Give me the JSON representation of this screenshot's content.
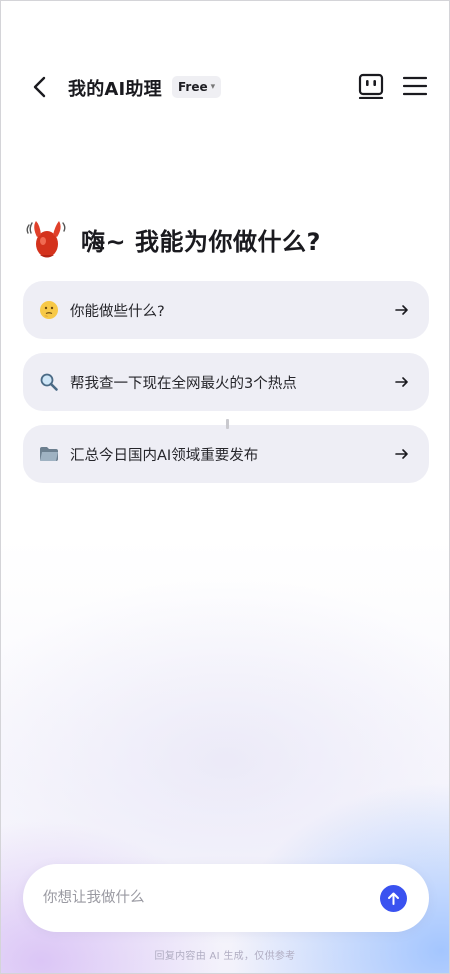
{
  "header": {
    "title": "我的AI助理",
    "plan_badge": "Free",
    "icons": [
      "back-arrow-icon",
      "robot-face-icon",
      "menu-icon"
    ]
  },
  "greeting": {
    "text": "嗨~ 我能为你做什么?",
    "icon": "lobster-icon"
  },
  "suggestions": [
    {
      "emoji": "thinking-face-icon",
      "label": "你能做些什么?"
    },
    {
      "emoji": "magnifying-glass-icon",
      "label": "帮我查一下现在全网最火的3个热点"
    },
    {
      "emoji": "folder-icon",
      "label": "汇总今日国内AI领域重要发布"
    }
  ],
  "input": {
    "placeholder": "你想让我做什么"
  },
  "footer": {
    "disclaimer": "回复内容由 AI 生成，仅供参考"
  },
  "colors": {
    "accent": "#3a52f0",
    "card_bg": "#eeeef5",
    "lobster": "#d4321c"
  }
}
